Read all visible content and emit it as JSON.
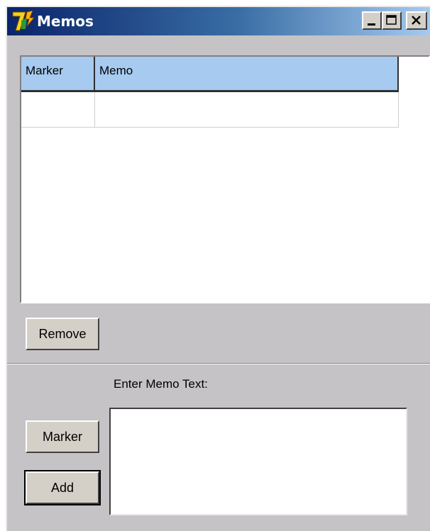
{
  "window": {
    "title": "Memos",
    "icon": "colorful-7-app-icon"
  },
  "titlebar_buttons": {
    "minimize_icon": "minimize-icon",
    "maximize_icon": "maximize-icon",
    "close_icon": "close-icon"
  },
  "memo_list": {
    "columns": [
      "Marker",
      "Memo"
    ],
    "rows": [
      {
        "marker": "",
        "memo": ""
      }
    ],
    "header_color": "#a6caf0"
  },
  "buttons": {
    "remove_label": "Remove",
    "marker_label": "Marker",
    "add_label": "Add"
  },
  "entry": {
    "label": "Enter Memo Text:",
    "value": ""
  }
}
